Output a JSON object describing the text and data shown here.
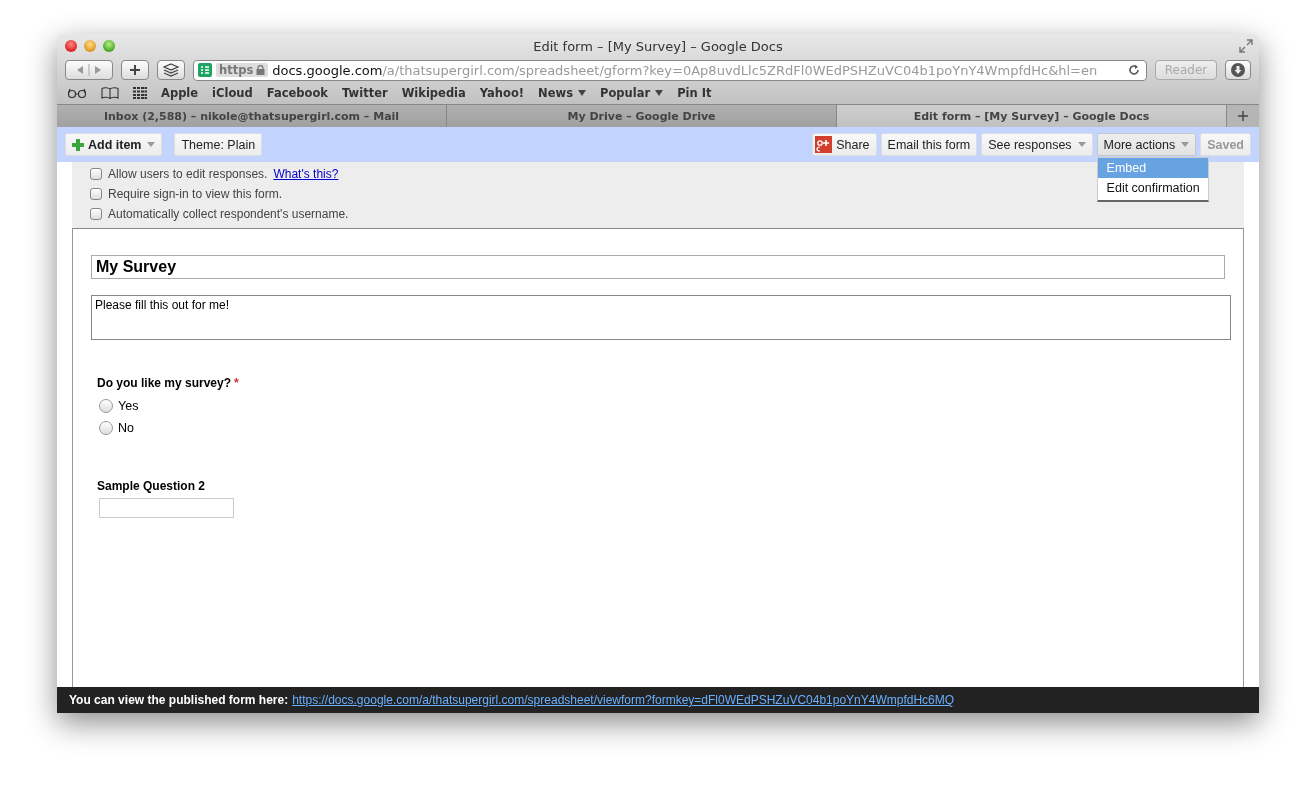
{
  "window": {
    "title": "Edit form – [My Survey] – Google Docs"
  },
  "address_bar": {
    "scheme": "https",
    "host": "docs.google.com",
    "path": "/a/thatsupergirl.com/spreadsheet/gform?key=0Ap8uvdLlc5ZRdFl0WEdPSHZuVC04b1poYnY4WmpfdHc&hl=en"
  },
  "reader_button": "Reader",
  "bookmarks": [
    {
      "label": "Apple",
      "menu": false
    },
    {
      "label": "iCloud",
      "menu": false
    },
    {
      "label": "Facebook",
      "menu": false
    },
    {
      "label": "Twitter",
      "menu": false
    },
    {
      "label": "Wikipedia",
      "menu": false
    },
    {
      "label": "Yahoo!",
      "menu": false
    },
    {
      "label": "News",
      "menu": true
    },
    {
      "label": "Popular",
      "menu": true
    },
    {
      "label": "Pin It",
      "menu": false
    }
  ],
  "tabs": [
    {
      "label": "Inbox (2,588) – nikole@thatsupergirl.com – Mail",
      "selected": false
    },
    {
      "label": "My Drive – Google Drive",
      "selected": false
    },
    {
      "label": "Edit form – [My Survey] – Google Docs",
      "selected": true
    }
  ],
  "app_toolbar": {
    "add_item": "Add item",
    "theme": "Theme:  Plain",
    "actions": [
      {
        "label": "Share",
        "kind": "share"
      },
      {
        "label": "Email this form",
        "kind": "plain"
      },
      {
        "label": "See responses",
        "kind": "menu",
        "expanded": false
      },
      {
        "label": "More actions",
        "kind": "menu",
        "expanded": true
      },
      {
        "label": "Saved",
        "kind": "disabled"
      }
    ]
  },
  "menu": [
    {
      "label": "Embed",
      "selected": true
    },
    {
      "label": "Edit confirmation",
      "selected": false
    }
  ],
  "options": [
    {
      "label": "Allow users to edit responses.",
      "link": "What's this?",
      "checked": false
    },
    {
      "label": "Require sign-in to view this form.",
      "checked": false
    },
    {
      "label": "Automatically collect respondent's username.",
      "checked": false
    }
  ],
  "form": {
    "title": "My Survey",
    "description": "Please fill this out for me!",
    "questions": [
      {
        "kind": "choice",
        "title": "Do you like my survey?",
        "required_mark": "*",
        "options": [
          {
            "label": "Yes",
            "selected": false
          },
          {
            "label": "No",
            "selected": false
          }
        ]
      },
      {
        "kind": "text",
        "title": "Sample Question 2"
      }
    ]
  },
  "footer": {
    "text": "You can view the published form here:",
    "link": "https://docs.google.com/a/thatsupergirl.com/spreadsheet/viewform?formkey=dFl0WEdPSHZuVC04b1poYnY4WmpfdHc6MQ"
  }
}
